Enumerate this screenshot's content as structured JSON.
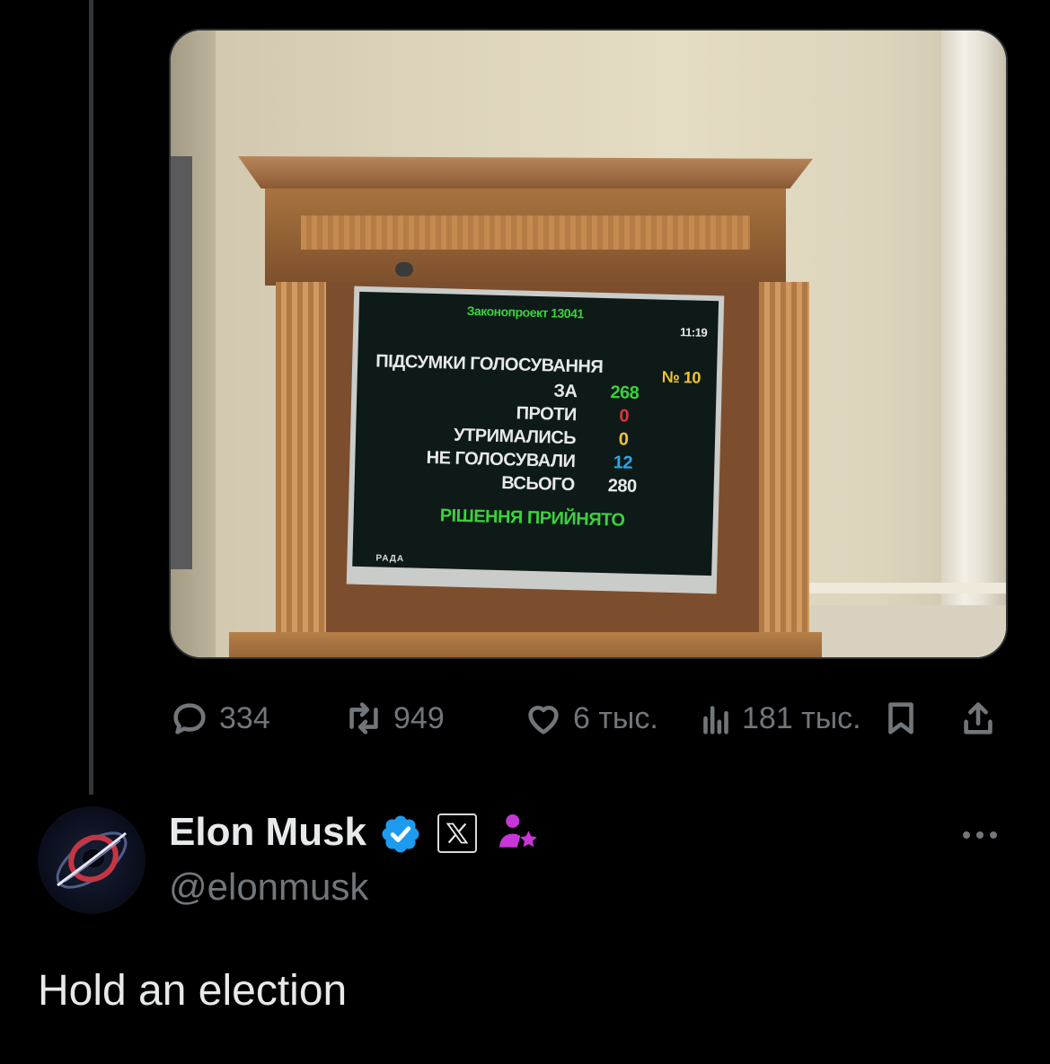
{
  "photo": {
    "board": {
      "header": "Законопроект 13041",
      "time": "11:19",
      "title": "ПІДСУМКИ ГОЛОСУВАННЯ",
      "number": "№ 10",
      "rows": [
        {
          "label": "ЗА",
          "value": "268",
          "color": "#3bd23b"
        },
        {
          "label": "ПРОТИ",
          "value": "0",
          "color": "#e2343a"
        },
        {
          "label": "УТРИМАЛИСЬ",
          "value": "0",
          "color": "#f2c430"
        },
        {
          "label": "НЕ ГОЛОСУВАЛИ",
          "value": "12",
          "color": "#29a8ea"
        },
        {
          "label": "ВСЬОГО",
          "value": "280",
          "color": "#e8e8e8"
        }
      ],
      "result": "РІШЕННЯ ПРИЙНЯТО",
      "logo": "РАДА"
    }
  },
  "actions": {
    "reply": {
      "icon": "reply-icon",
      "count": "334"
    },
    "repost": {
      "icon": "repost-icon",
      "count": "949"
    },
    "like": {
      "icon": "like-icon",
      "count": "6 тыс."
    },
    "views": {
      "icon": "views-icon",
      "count": "181 тыс."
    },
    "bookmark": {
      "icon": "bookmark-icon"
    },
    "share": {
      "icon": "share-icon"
    }
  },
  "author": {
    "name": "Elon Musk",
    "handle": "@elonmusk",
    "verified_color": "#1d9bf0",
    "affiliate_color": "#c936d8"
  },
  "post": {
    "text": "Hold an election"
  }
}
